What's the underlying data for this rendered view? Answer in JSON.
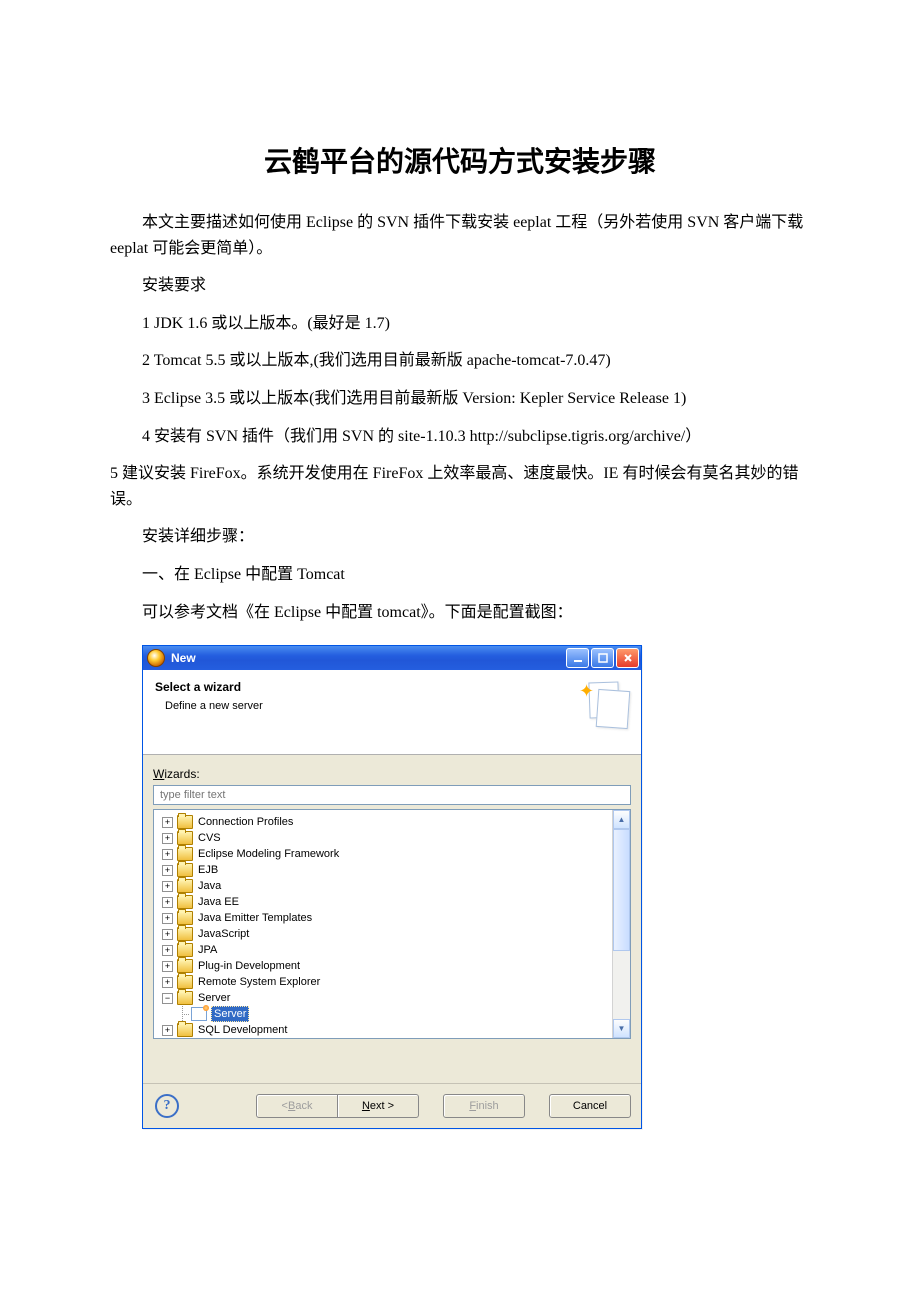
{
  "document": {
    "title": "云鹤平台的源代码方式安装步骤",
    "p1": "本文主要描述如何使用 Eclipse 的 SVN 插件下载安装 eeplat 工程（另外若使用 SVN 客户端下载 eeplat 可能会更简单）。",
    "p2": "安装要求",
    "p3": "1 JDK 1.6 或以上版本。(最好是 1.7)",
    "p4": "2 Tomcat 5.5 或以上版本,(我们选用目前最新版 apache-tomcat-7.0.47)",
    "p5": "3 Eclipse 3.5 或以上版本(我们选用目前最新版 Version: Kepler Service Release 1)",
    "p6": "4 安装有 SVN 插件（我们用 SVN 的 site-1.10.3 http://subclipse.tigris.org/archive/）",
    "p7": "5 建议安装 FireFox。系统开发使用在 FireFox 上效率最高、速度最快。IE 有时候会有莫名其妙的错误。",
    "p8": "安装详细步骤：",
    "p9": "一、在 Eclipse 中配置 Tomcat",
    "p10": "可以参考文档《在 Eclipse 中配置 tomcat》。下面是配置截图："
  },
  "wizard": {
    "title": "New",
    "banner_title": "Select a wizard",
    "banner_sub": "Define a new server",
    "wizards_label_pre": "W",
    "wizards_label_post": "izards:",
    "filter_placeholder": "type filter text",
    "tree": {
      "items": [
        {
          "label": "Connection Profiles",
          "expandable": true,
          "expanded": false
        },
        {
          "label": "CVS",
          "expandable": true,
          "expanded": false
        },
        {
          "label": "Eclipse Modeling Framework",
          "expandable": true,
          "expanded": false
        },
        {
          "label": "EJB",
          "expandable": true,
          "expanded": false
        },
        {
          "label": "Java",
          "expandable": true,
          "expanded": false
        },
        {
          "label": "Java EE",
          "expandable": true,
          "expanded": false
        },
        {
          "label": "Java Emitter Templates",
          "expandable": true,
          "expanded": false
        },
        {
          "label": "JavaScript",
          "expandable": true,
          "expanded": false
        },
        {
          "label": "JPA",
          "expandable": true,
          "expanded": false
        },
        {
          "label": "Plug-in Development",
          "expandable": true,
          "expanded": false
        },
        {
          "label": "Remote System Explorer",
          "expandable": true,
          "expanded": false
        },
        {
          "label": "Server",
          "expandable": true,
          "expanded": true,
          "children": [
            {
              "label": "Server",
              "selected": true
            }
          ]
        },
        {
          "label": "SQL Development",
          "expandable": true,
          "expanded": false
        }
      ]
    },
    "buttons": {
      "back": {
        "mn": "B",
        "rest": "ack",
        "prefix": "< "
      },
      "next": {
        "mn": "N",
        "rest": "ext >",
        "prefix": ""
      },
      "finish": {
        "mn": "F",
        "rest": "inish",
        "prefix": ""
      },
      "cancel": "Cancel"
    }
  }
}
